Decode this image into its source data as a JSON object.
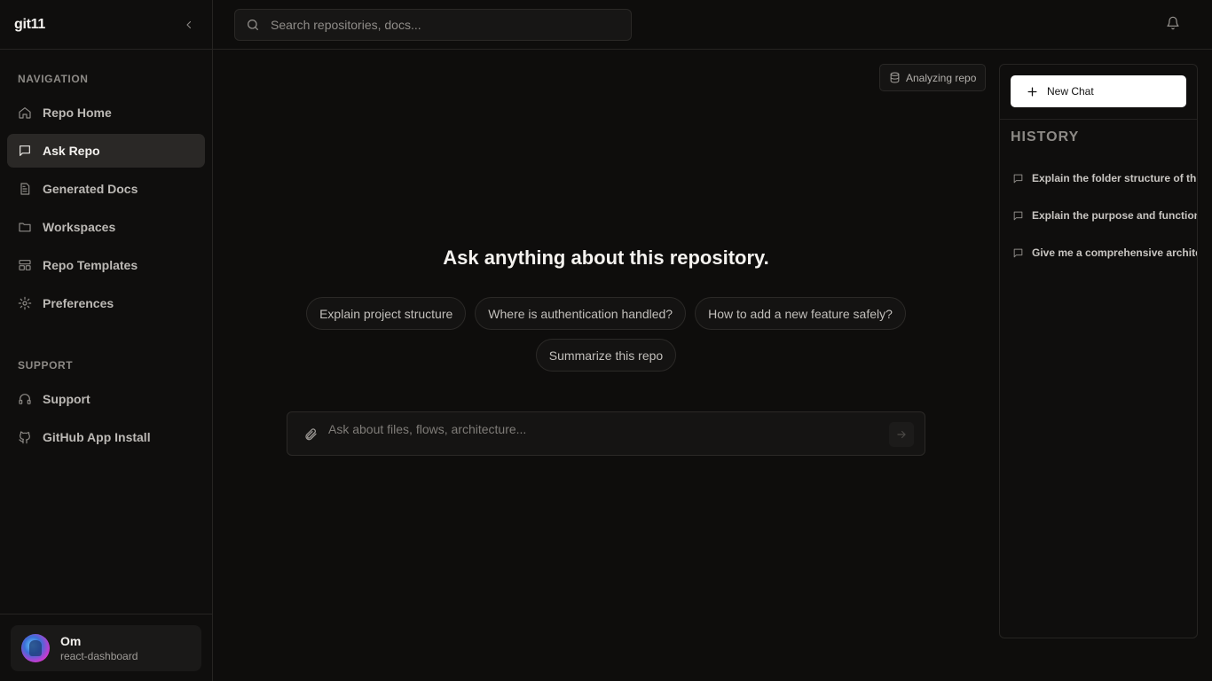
{
  "app": {
    "logo": "git11"
  },
  "sidebar": {
    "navigation_title": "NAVIGATION",
    "nav_items": [
      {
        "label": "Repo Home",
        "icon": "home-icon",
        "active": false
      },
      {
        "label": "Ask Repo",
        "icon": "chat-icon",
        "active": true
      },
      {
        "label": "Generated Docs",
        "icon": "document-icon",
        "active": false
      },
      {
        "label": "Workspaces",
        "icon": "folder-icon",
        "active": false
      },
      {
        "label": "Repo Templates",
        "icon": "layout-icon",
        "active": false
      },
      {
        "label": "Preferences",
        "icon": "gear-icon",
        "active": false
      }
    ],
    "support_title": "SUPPORT",
    "support_items": [
      {
        "label": "Support",
        "icon": "headphones-icon"
      },
      {
        "label": "GitHub App Install",
        "icon": "github-icon"
      }
    ],
    "user": {
      "name": "Om",
      "repo": "react-dashboard"
    }
  },
  "topbar": {
    "search_placeholder": "Search repositories, docs..."
  },
  "main": {
    "status": "Analyzing repo",
    "headline": "Ask anything about this repository.",
    "suggestions": [
      "Explain project structure",
      "Where is authentication handled?",
      "How to add a new feature safely?",
      "Summarize this repo"
    ],
    "ask_placeholder": "Ask about files, flows, architecture..."
  },
  "history_panel": {
    "new_chat_label": "New Chat",
    "title": "HISTORY",
    "items": [
      "Explain the folder structure of this r",
      "Explain the purpose and functional",
      "Give me a comprehensive architect"
    ]
  },
  "colors": {
    "background": "#0e0d0c",
    "active_nav": "#2a2826",
    "border": "#262422",
    "new_chat_bg": "#ffffff"
  }
}
